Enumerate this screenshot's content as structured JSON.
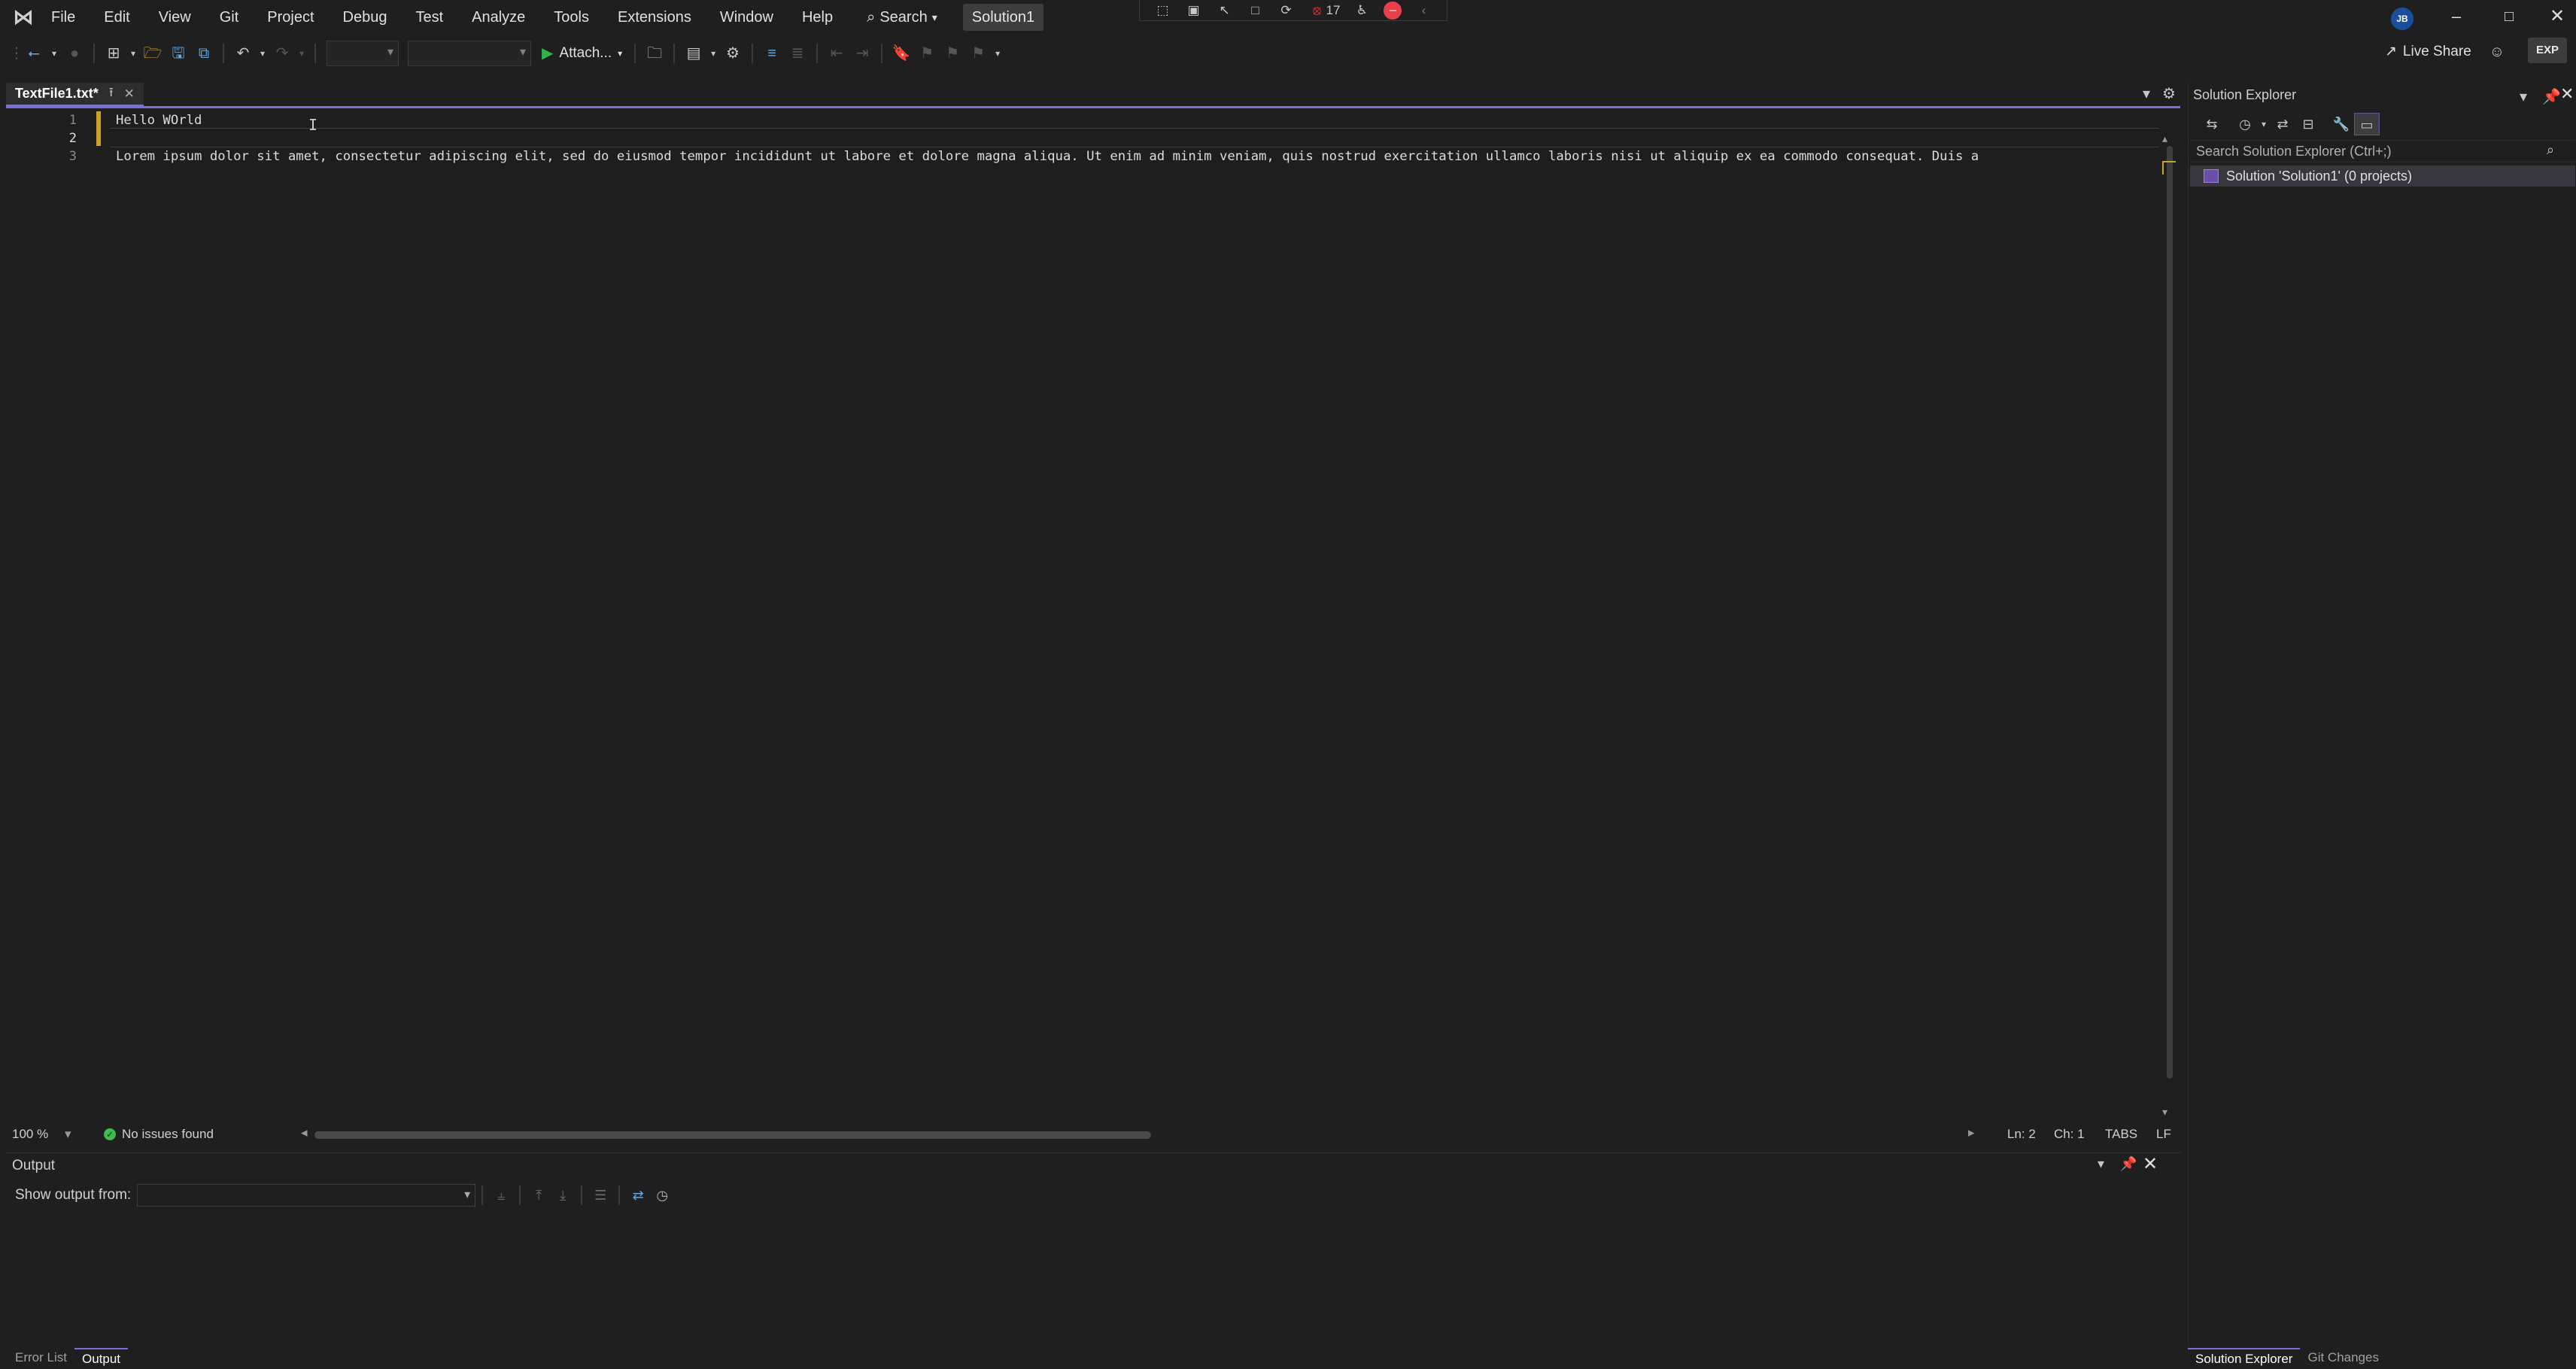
{
  "menubar": {
    "items": [
      "File",
      "Edit",
      "View",
      "Git",
      "Project",
      "Debug",
      "Test",
      "Analyze",
      "Tools",
      "Extensions",
      "Window",
      "Help"
    ],
    "search_label": "Search",
    "solution_name": "Solution1"
  },
  "debug_toolbar": {
    "counter": "17"
  },
  "user": {
    "initials": "JB"
  },
  "toolbar": {
    "attach_label": "Attach...",
    "live_share_label": "Live Share",
    "exp_badge": "EXP"
  },
  "editor": {
    "tab_title": "TextFile1.txt*",
    "lines": [
      {
        "number": "1",
        "text": "Hello WOrld"
      },
      {
        "number": "2",
        "text": ""
      },
      {
        "number": "3",
        "text": "Lorem ipsum dolor sit amet, consectetur adipiscing elit, sed do eiusmod tempor incididunt ut labore et dolore magna aliqua. Ut enim ad minim veniam, quis nostrud exercitation ullamco laboris nisi ut aliquip ex ea commodo consequat. Duis a"
      }
    ],
    "active_line": "2"
  },
  "status": {
    "zoom": "100 %",
    "issues": "No issues found",
    "line": "Ln: 2",
    "column": "Ch: 1",
    "indent": "TABS",
    "line_ending": "LF"
  },
  "output": {
    "title": "Output",
    "show_output_from_label": "Show output from:",
    "source_value": ""
  },
  "bottom_tabs": [
    "Error List",
    "Output"
  ],
  "bottom_active": "Output",
  "solution_explorer": {
    "title": "Solution Explorer",
    "search_placeholder": "Search Solution Explorer (Ctrl+;)",
    "root_item": "Solution 'Solution1' (0 projects)",
    "tabs": [
      "Solution Explorer",
      "Git Changes"
    ]
  }
}
